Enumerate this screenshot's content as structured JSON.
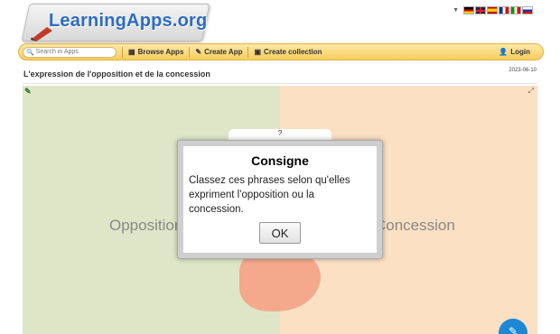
{
  "header": {
    "logo_text": "LearningApps.org",
    "languages": [
      "de",
      "en",
      "es",
      "fr",
      "it",
      "ru"
    ]
  },
  "navbar": {
    "search_placeholder": "Search in Apps",
    "browse_label": "Browse Apps",
    "create_app_label": "Create App",
    "create_collection_label": "Create collection",
    "login_label": "Login"
  },
  "app": {
    "title": "L'expression de l'opposition et de la concession",
    "date": "2023-06-10",
    "zone_left_label": "Opposition",
    "zone_right_label": "Concession",
    "help_tab": "?"
  },
  "dialog": {
    "title": "Consigne",
    "text": "Classez ces phrases selon qu'elles expriment l'opposition ou la concession.",
    "ok_label": "OK"
  },
  "colors": {
    "zone_left": "#dfe6c8",
    "zone_right": "#fbe0c4",
    "navbar": "#f7cd5e",
    "logo": "#2b6cc4"
  }
}
